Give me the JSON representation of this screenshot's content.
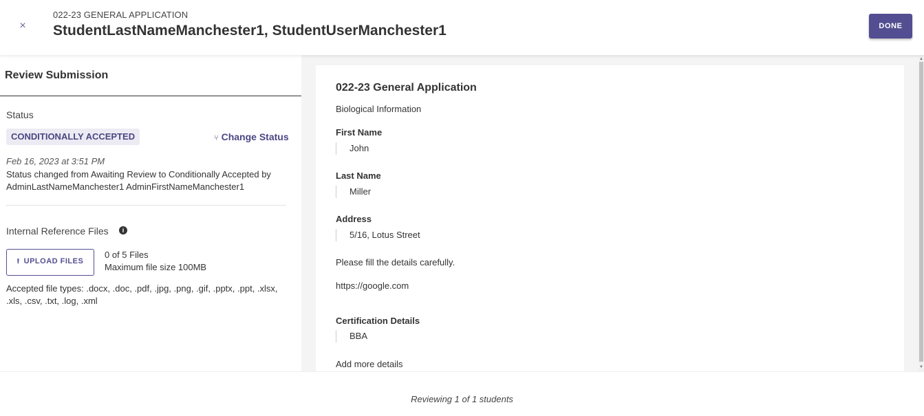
{
  "header": {
    "close_icon": "×",
    "application_label": "022-23 GENERAL APPLICATION",
    "student_name": "StudentLastNameManchester1, StudentUserManchester1",
    "done_label": "DONE"
  },
  "left_panel": {
    "title": "Review Submission",
    "status_label": "Status",
    "status_value": "CONDITIONALLY ACCEPTED",
    "change_status_icon": "fork-icon",
    "change_status_label": "Change Status",
    "status_date": "Feb 16, 2023 at 3:51 PM",
    "status_description": "Status changed from Awaiting Review to Conditionally Accepted by AdminLastNameManchester1 AdminFirstNameManchester1",
    "files_label": "Internal Reference Files",
    "info_icon": "i",
    "upload_icon": "upload-icon",
    "upload_label": "UPLOAD FILES",
    "files_count": "0 of 5 Files",
    "max_size": "Maximum file size 100MB",
    "accepted_types": "Accepted file types: .docx, .doc, .pdf, .jpg, .png, .gif, .pptx, .ppt, .xlsx, .xls, .csv, .txt, .log, .xml"
  },
  "form": {
    "title": "022-23 General Application",
    "section": "Biological Information",
    "fields": [
      {
        "label": "First Name",
        "value": "John"
      },
      {
        "label": "Last Name",
        "value": "Miller"
      },
      {
        "label": "Address",
        "value": "5/16, Lotus Street"
      }
    ],
    "note": "Please fill the details carefully.",
    "link": "https://google.com",
    "certification": {
      "label": "Certification Details",
      "value": "BBA"
    },
    "more": "Add more details"
  },
  "footer": {
    "text": "Reviewing 1 of 1 students"
  },
  "colors": {
    "accent": "#534e91",
    "badge_bg": "#ecebf3",
    "panel_bg": "#f4f4f4"
  }
}
